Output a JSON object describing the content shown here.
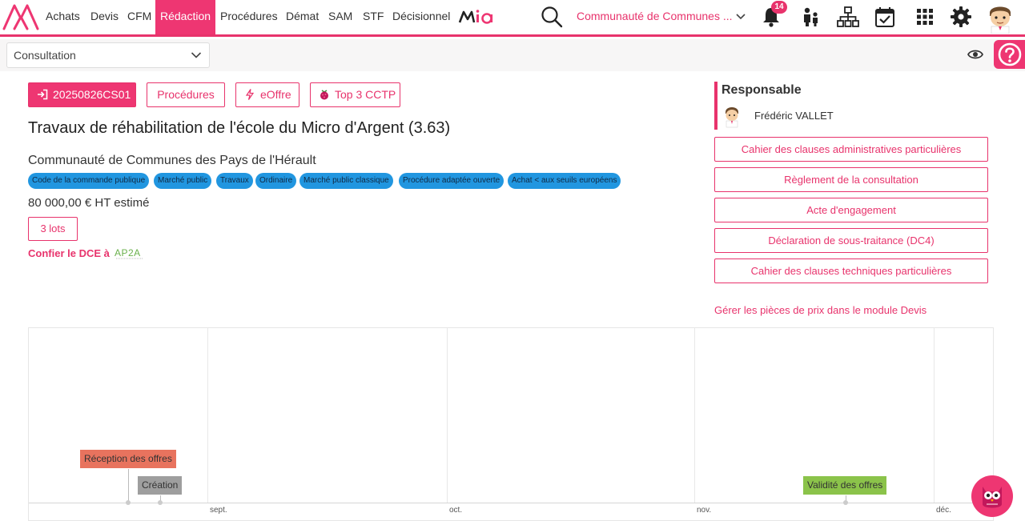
{
  "nav": {
    "items": [
      "Achats",
      "Devis",
      "CFM",
      "Rédaction",
      "Procédures",
      "Démat",
      "SAM",
      "STF",
      "Décisionnel"
    ],
    "active": "Rédaction",
    "mia_logo": "Mia",
    "organization": "Communauté de Communes ...",
    "notifications_count": "14",
    "icons": [
      "search-icon",
      "bell-icon",
      "users-icon",
      "org-chart-icon",
      "calendar-check-icon",
      "apps-grid-icon",
      "gear-icon"
    ]
  },
  "subbar": {
    "mode": "Consultation",
    "help_icon": "question-icon"
  },
  "consultation": {
    "reference": "20250826CS01",
    "buttons": [
      "Procédures",
      "eOffre",
      "Top 3 CCTP"
    ],
    "title": "Travaux de réhabilitation de l'école du Micro d'Argent (3.63)",
    "organization": "Communauté de Communes des Pays de l'Hérault",
    "chips": [
      "Code de la commande publique",
      "Marché public",
      "Travaux",
      "Ordinaire",
      "Marché public classique",
      "Procédure adaptée ouverte",
      "Achat < aux seuils européens"
    ],
    "estimate": "80 000,00 € HT estimé",
    "lots": "3 lots",
    "dce_label": "Confier le DCE à",
    "dce_partner": "AP2A"
  },
  "responsable": {
    "title": "Responsable",
    "name": "Frédéric VALLET"
  },
  "documents": [
    "Cahier des clauses administratives particulières",
    "Règlement de la consultation",
    "Acte d'engagement",
    "Déclaration de sous-traitance (DC4)",
    "Cahier des clauses techniques particulières"
  ],
  "devis_link": "Gérer les pièces de prix dans le module Devis",
  "timeline": {
    "months": [
      "sept.",
      "oct.",
      "nov.",
      "déc."
    ],
    "events": [
      {
        "label": "Réception des offres",
        "color": "#e8735e"
      },
      {
        "label": "Création",
        "color": "#9e9e9e"
      },
      {
        "label": "Validité des offres",
        "color": "#8bc34a"
      }
    ]
  },
  "colors": {
    "accent": "#e8336c",
    "chip": "#2196e0"
  }
}
